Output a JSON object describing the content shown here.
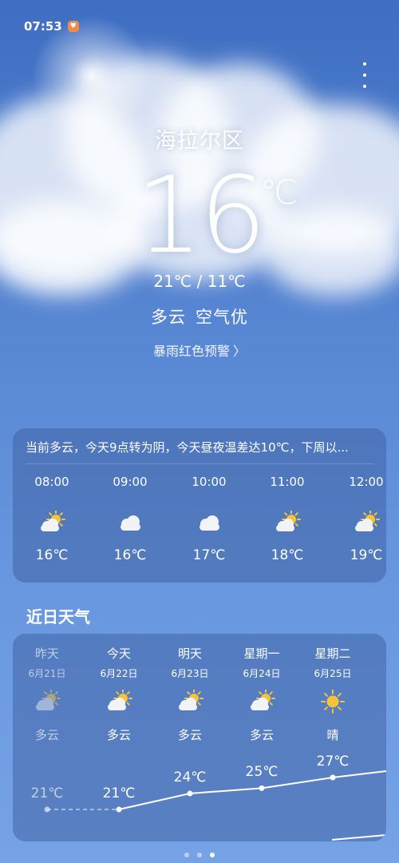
{
  "status": {
    "time": "07:53",
    "badge_icon": "heart-badge-icon"
  },
  "location": "海拉尔区",
  "current": {
    "temp": "16",
    "unit": "℃",
    "range": "21℃ / 11℃",
    "condition": "多云",
    "air": "空气优",
    "alert": "暴雨红色预警"
  },
  "hourly": {
    "summary": "当前多云，今天9点转为阴，今天昼夜温差达10℃，下周以...",
    "items": [
      {
        "time": "08:00",
        "icon": "partly-cloudy-icon",
        "temp": "16℃"
      },
      {
        "time": "09:00",
        "icon": "cloudy-icon",
        "temp": "16℃"
      },
      {
        "time": "10:00",
        "icon": "cloudy-icon",
        "temp": "17℃"
      },
      {
        "time": "11:00",
        "icon": "partly-cloudy-icon",
        "temp": "18℃"
      },
      {
        "time": "12:00",
        "icon": "partly-cloudy-icon",
        "temp": "19℃"
      }
    ]
  },
  "daily": {
    "title": "近日天气",
    "items": [
      {
        "day": "昨天",
        "date": "6月21日",
        "icon": "partly-cloudy-icon",
        "cond": "多云",
        "high": "21℃",
        "past": true
      },
      {
        "day": "今天",
        "date": "6月22日",
        "icon": "partly-cloudy-icon",
        "cond": "多云",
        "high": "21℃",
        "past": false
      },
      {
        "day": "明天",
        "date": "6月23日",
        "icon": "partly-cloudy-icon",
        "cond": "多云",
        "high": "24℃",
        "past": false
      },
      {
        "day": "星期一",
        "date": "6月24日",
        "icon": "partly-cloudy-icon",
        "cond": "多云",
        "high": "25℃",
        "past": false
      },
      {
        "day": "星期二",
        "date": "6月25日",
        "icon": "sunny-icon",
        "cond": "晴",
        "high": "27℃",
        "past": false
      }
    ]
  },
  "pager": {
    "count": 3,
    "active": 2
  }
}
